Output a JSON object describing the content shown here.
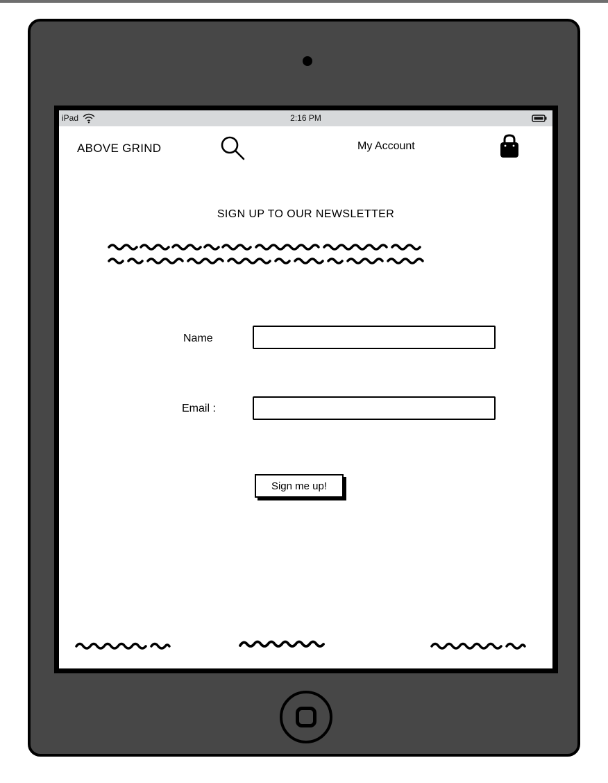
{
  "status_bar": {
    "device": "iPad",
    "time": "2:16 PM"
  },
  "nav": {
    "brand": "ABOVE GRIND",
    "account": "My Account"
  },
  "newsletter": {
    "title": "SIGN UP TO OUR NEWSLETTER",
    "name_label": "Name",
    "email_label": "Email :",
    "name_value": "",
    "email_value": "",
    "submit_label": "Sign me up!"
  },
  "colors": {
    "device": "#474747",
    "statusbar": "#d7d9db",
    "frame": "#000000"
  },
  "icons": [
    "wifi-icon",
    "battery-icon",
    "search-icon",
    "shopping-bag-icon",
    "home-button-icon"
  ]
}
